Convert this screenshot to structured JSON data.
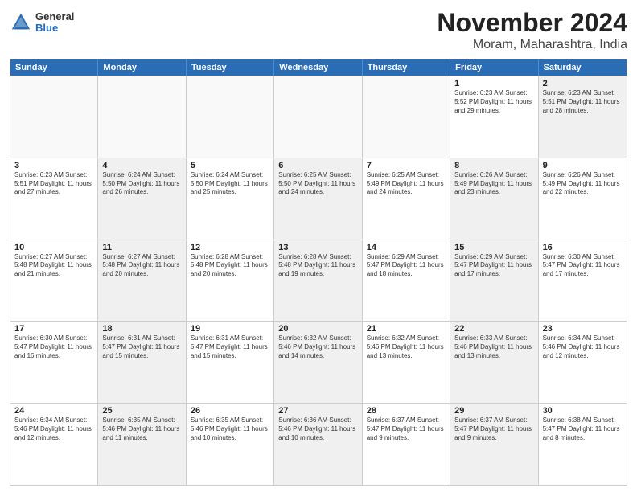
{
  "header": {
    "logo": {
      "general": "General",
      "blue": "Blue"
    },
    "title": "November 2024",
    "subtitle": "Moram, Maharashtra, India"
  },
  "weekdays": [
    "Sunday",
    "Monday",
    "Tuesday",
    "Wednesday",
    "Thursday",
    "Friday",
    "Saturday"
  ],
  "rows": [
    [
      {
        "day": "",
        "info": "",
        "empty": true
      },
      {
        "day": "",
        "info": "",
        "empty": true
      },
      {
        "day": "",
        "info": "",
        "empty": true
      },
      {
        "day": "",
        "info": "",
        "empty": true
      },
      {
        "day": "",
        "info": "",
        "empty": true
      },
      {
        "day": "1",
        "info": "Sunrise: 6:23 AM\nSunset: 5:52 PM\nDaylight: 11 hours\nand 29 minutes.",
        "empty": false
      },
      {
        "day": "2",
        "info": "Sunrise: 6:23 AM\nSunset: 5:51 PM\nDaylight: 11 hours\nand 28 minutes.",
        "empty": false,
        "shaded": true
      }
    ],
    [
      {
        "day": "3",
        "info": "Sunrise: 6:23 AM\nSunset: 5:51 PM\nDaylight: 11 hours\nand 27 minutes.",
        "empty": false
      },
      {
        "day": "4",
        "info": "Sunrise: 6:24 AM\nSunset: 5:50 PM\nDaylight: 11 hours\nand 26 minutes.",
        "empty": false,
        "shaded": true
      },
      {
        "day": "5",
        "info": "Sunrise: 6:24 AM\nSunset: 5:50 PM\nDaylight: 11 hours\nand 25 minutes.",
        "empty": false
      },
      {
        "day": "6",
        "info": "Sunrise: 6:25 AM\nSunset: 5:50 PM\nDaylight: 11 hours\nand 24 minutes.",
        "empty": false,
        "shaded": true
      },
      {
        "day": "7",
        "info": "Sunrise: 6:25 AM\nSunset: 5:49 PM\nDaylight: 11 hours\nand 24 minutes.",
        "empty": false
      },
      {
        "day": "8",
        "info": "Sunrise: 6:26 AM\nSunset: 5:49 PM\nDaylight: 11 hours\nand 23 minutes.",
        "empty": false,
        "shaded": true
      },
      {
        "day": "9",
        "info": "Sunrise: 6:26 AM\nSunset: 5:49 PM\nDaylight: 11 hours\nand 22 minutes.",
        "empty": false
      }
    ],
    [
      {
        "day": "10",
        "info": "Sunrise: 6:27 AM\nSunset: 5:48 PM\nDaylight: 11 hours\nand 21 minutes.",
        "empty": false
      },
      {
        "day": "11",
        "info": "Sunrise: 6:27 AM\nSunset: 5:48 PM\nDaylight: 11 hours\nand 20 minutes.",
        "empty": false,
        "shaded": true
      },
      {
        "day": "12",
        "info": "Sunrise: 6:28 AM\nSunset: 5:48 PM\nDaylight: 11 hours\nand 20 minutes.",
        "empty": false
      },
      {
        "day": "13",
        "info": "Sunrise: 6:28 AM\nSunset: 5:48 PM\nDaylight: 11 hours\nand 19 minutes.",
        "empty": false,
        "shaded": true
      },
      {
        "day": "14",
        "info": "Sunrise: 6:29 AM\nSunset: 5:47 PM\nDaylight: 11 hours\nand 18 minutes.",
        "empty": false
      },
      {
        "day": "15",
        "info": "Sunrise: 6:29 AM\nSunset: 5:47 PM\nDaylight: 11 hours\nand 17 minutes.",
        "empty": false,
        "shaded": true
      },
      {
        "day": "16",
        "info": "Sunrise: 6:30 AM\nSunset: 5:47 PM\nDaylight: 11 hours\nand 17 minutes.",
        "empty": false
      }
    ],
    [
      {
        "day": "17",
        "info": "Sunrise: 6:30 AM\nSunset: 5:47 PM\nDaylight: 11 hours\nand 16 minutes.",
        "empty": false
      },
      {
        "day": "18",
        "info": "Sunrise: 6:31 AM\nSunset: 5:47 PM\nDaylight: 11 hours\nand 15 minutes.",
        "empty": false,
        "shaded": true
      },
      {
        "day": "19",
        "info": "Sunrise: 6:31 AM\nSunset: 5:47 PM\nDaylight: 11 hours\nand 15 minutes.",
        "empty": false
      },
      {
        "day": "20",
        "info": "Sunrise: 6:32 AM\nSunset: 5:46 PM\nDaylight: 11 hours\nand 14 minutes.",
        "empty": false,
        "shaded": true
      },
      {
        "day": "21",
        "info": "Sunrise: 6:32 AM\nSunset: 5:46 PM\nDaylight: 11 hours\nand 13 minutes.",
        "empty": false
      },
      {
        "day": "22",
        "info": "Sunrise: 6:33 AM\nSunset: 5:46 PM\nDaylight: 11 hours\nand 13 minutes.",
        "empty": false,
        "shaded": true
      },
      {
        "day": "23",
        "info": "Sunrise: 6:34 AM\nSunset: 5:46 PM\nDaylight: 11 hours\nand 12 minutes.",
        "empty": false
      }
    ],
    [
      {
        "day": "24",
        "info": "Sunrise: 6:34 AM\nSunset: 5:46 PM\nDaylight: 11 hours\nand 12 minutes.",
        "empty": false
      },
      {
        "day": "25",
        "info": "Sunrise: 6:35 AM\nSunset: 5:46 PM\nDaylight: 11 hours\nand 11 minutes.",
        "empty": false,
        "shaded": true
      },
      {
        "day": "26",
        "info": "Sunrise: 6:35 AM\nSunset: 5:46 PM\nDaylight: 11 hours\nand 10 minutes.",
        "empty": false
      },
      {
        "day": "27",
        "info": "Sunrise: 6:36 AM\nSunset: 5:46 PM\nDaylight: 11 hours\nand 10 minutes.",
        "empty": false,
        "shaded": true
      },
      {
        "day": "28",
        "info": "Sunrise: 6:37 AM\nSunset: 5:47 PM\nDaylight: 11 hours\nand 9 minutes.",
        "empty": false
      },
      {
        "day": "29",
        "info": "Sunrise: 6:37 AM\nSunset: 5:47 PM\nDaylight: 11 hours\nand 9 minutes.",
        "empty": false,
        "shaded": true
      },
      {
        "day": "30",
        "info": "Sunrise: 6:38 AM\nSunset: 5:47 PM\nDaylight: 11 hours\nand 8 minutes.",
        "empty": false
      }
    ]
  ]
}
